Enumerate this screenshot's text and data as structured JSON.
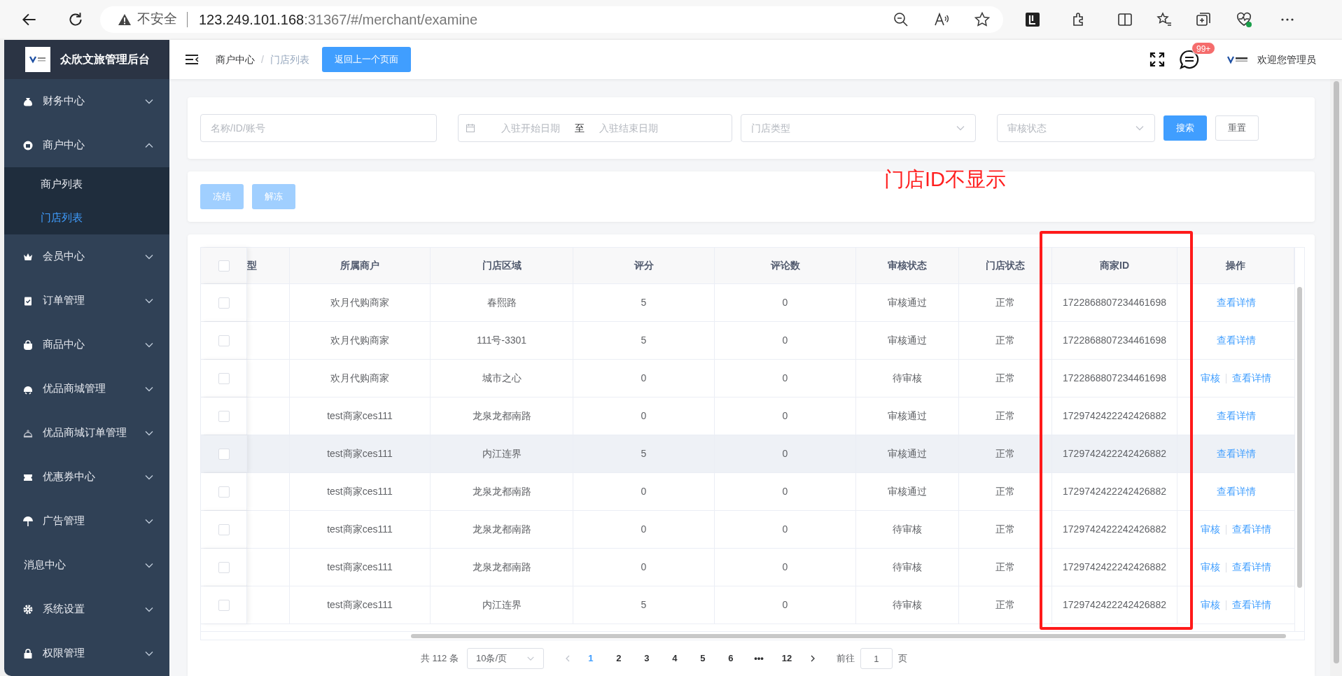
{
  "browser": {
    "security_label": "不安全",
    "url_host": "123.249.101.168",
    "url_path": ":31367/#/merchant/examine"
  },
  "sidebar": {
    "title": "众欣文旅管理后台",
    "items": [
      {
        "label": "财务中心",
        "expanded": false
      },
      {
        "label": "商户中心",
        "expanded": true,
        "children": [
          {
            "label": "商户列表",
            "selected": false
          },
          {
            "label": "门店列表",
            "selected": true
          }
        ]
      },
      {
        "label": "会员中心",
        "expanded": false
      },
      {
        "label": "订单管理",
        "expanded": false
      },
      {
        "label": "商品中心",
        "expanded": false
      },
      {
        "label": "优品商城管理",
        "expanded": false
      },
      {
        "label": "优品商城订单管理",
        "expanded": false
      },
      {
        "label": "优惠券中心",
        "expanded": false
      },
      {
        "label": "广告管理",
        "expanded": false
      },
      {
        "label": "消息中心",
        "expanded": false
      },
      {
        "label": "系统设置",
        "expanded": false
      },
      {
        "label": "权限管理",
        "expanded": false
      }
    ]
  },
  "header": {
    "breadcrumb": [
      "商户中心",
      "门店列表"
    ],
    "breadcrumb_separator": "/",
    "back_button": "返回上一个页面",
    "message_badge": "99+",
    "user_greeting": "欢迎您管理员"
  },
  "filters": {
    "name": {
      "placeholder": "名称/ID/账号"
    },
    "date_start": {
      "placeholder": "入驻开始日期"
    },
    "date_separator": "至",
    "date_end": {
      "placeholder": "入驻结束日期"
    },
    "store_type": {
      "placeholder": "门店类型"
    },
    "review_status": {
      "placeholder": "审核状态"
    },
    "search_button": "搜索",
    "reset_button": "重置"
  },
  "actions": [
    {
      "label": "冻结",
      "disabled": true
    },
    {
      "label": "解冻",
      "disabled": true
    }
  ],
  "annotation": "门店ID不显示",
  "table": {
    "all_checked": false,
    "columns": [
      "型",
      "所属商户",
      "门店区域",
      "评分",
      "评论数",
      "审核状态",
      "门店状态",
      "商家ID",
      "操作"
    ],
    "rows": [
      {
        "checked": false,
        "hovered": false,
        "cells": [
          "",
          "欢月代购商家",
          "春熙路",
          "5",
          "0",
          "审核通过",
          "正常",
          "1722868807234461698"
        ],
        "actions": [
          "查看详情"
        ]
      },
      {
        "checked": false,
        "hovered": false,
        "cells": [
          "",
          "欢月代购商家",
          "111号-3301",
          "5",
          "0",
          "审核通过",
          "正常",
          "1722868807234461698"
        ],
        "actions": [
          "查看详情"
        ]
      },
      {
        "checked": false,
        "hovered": false,
        "cells": [
          "",
          "欢月代购商家",
          "城市之心",
          "0",
          "0",
          "待审核",
          "正常",
          "1722868807234461698"
        ],
        "actions": [
          "审核",
          "查看详情"
        ]
      },
      {
        "checked": false,
        "hovered": false,
        "cells": [
          "",
          "test商家ces111",
          "龙泉龙都南路",
          "0",
          "0",
          "审核通过",
          "正常",
          "1729742422242426882"
        ],
        "actions": [
          "查看详情"
        ]
      },
      {
        "checked": false,
        "hovered": true,
        "cells": [
          "",
          "test商家ces111",
          "内江连界",
          "5",
          "0",
          "审核通过",
          "正常",
          "1729742422242426882"
        ],
        "actions": [
          "查看详情"
        ]
      },
      {
        "checked": false,
        "hovered": false,
        "cells": [
          "",
          "test商家ces111",
          "龙泉龙都南路",
          "0",
          "0",
          "审核通过",
          "正常",
          "1729742422242426882"
        ],
        "actions": [
          "查看详情"
        ]
      },
      {
        "checked": false,
        "hovered": false,
        "cells": [
          "",
          "test商家ces111",
          "龙泉龙都南路",
          "0",
          "0",
          "待审核",
          "正常",
          "1729742422242426882"
        ],
        "actions": [
          "审核",
          "查看详情"
        ]
      },
      {
        "checked": false,
        "hovered": false,
        "cells": [
          "",
          "test商家ces111",
          "龙泉龙都南路",
          "0",
          "0",
          "待审核",
          "正常",
          "1729742422242426882"
        ],
        "actions": [
          "审核",
          "查看详情"
        ]
      },
      {
        "checked": false,
        "hovered": false,
        "cells": [
          "",
          "test商家ces111",
          "内江连界",
          "5",
          "0",
          "待审核",
          "正常",
          "1729742422242426882"
        ],
        "actions": [
          "审核",
          "查看详情"
        ]
      }
    ]
  },
  "pagination": {
    "total": "共 112 条",
    "page_size": "10条/页",
    "pages": [
      {
        "label": "1",
        "selected": true
      },
      {
        "label": "2",
        "selected": false
      },
      {
        "label": "3",
        "selected": false
      },
      {
        "label": "4",
        "selected": false
      },
      {
        "label": "5",
        "selected": false
      },
      {
        "label": "6",
        "selected": false
      },
      {
        "label": "•••",
        "selected": false
      },
      {
        "label": "12",
        "selected": false
      }
    ],
    "goto_label": "前往",
    "goto_value": "1",
    "page_suffix": "页"
  }
}
